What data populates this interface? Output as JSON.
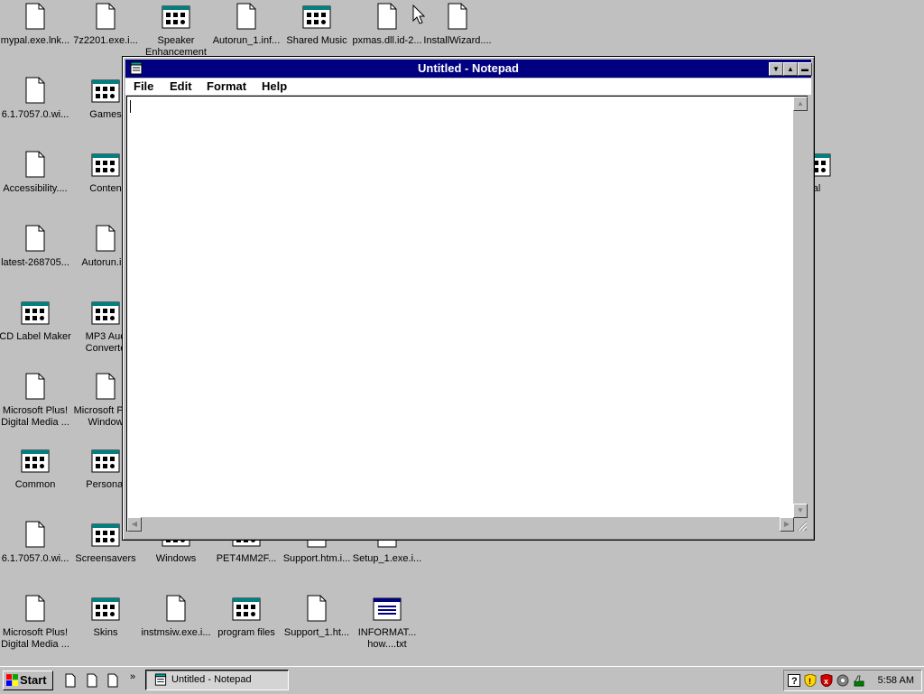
{
  "desktop": {
    "icons": [
      {
        "label": "mypal.exe.lnk...",
        "type": "doc"
      },
      {
        "label": "7z2201.exe.i...",
        "type": "doc"
      },
      {
        "label": "Speaker Enhancement",
        "type": "group"
      },
      {
        "label": "Autorun_1.inf...",
        "type": "doc"
      },
      {
        "label": "Shared Music",
        "type": "group"
      },
      {
        "label": "pxmas.dll.id-2...",
        "type": "doc"
      },
      {
        "label": "InstallWizard....",
        "type": "doc"
      },
      {
        "label": "6.1.7057.0.wi...",
        "type": "doc"
      },
      {
        "label": "Games",
        "type": "group"
      },
      {
        "label": "Accessibility....",
        "type": "doc"
      },
      {
        "label": "Conten",
        "type": "group"
      },
      {
        "label": "al",
        "type": "group"
      },
      {
        "label": "latest-268705...",
        "type": "doc"
      },
      {
        "label": "Autorun.inf",
        "type": "doc"
      },
      {
        "label": "CD Label Maker",
        "type": "group"
      },
      {
        "label": "MP3 Aud Converte",
        "type": "group"
      },
      {
        "label": "Microsoft Plus! Digital Media ...",
        "type": "doc"
      },
      {
        "label": "Microsoft P for Window",
        "type": "doc"
      },
      {
        "label": "Common",
        "type": "group"
      },
      {
        "label": "Personal",
        "type": "group"
      },
      {
        "label": "6.1.7057.0.wi...",
        "type": "doc"
      },
      {
        "label": "Screensavers",
        "type": "group"
      },
      {
        "label": "Windows",
        "type": "group"
      },
      {
        "label": "PET4MM2F...",
        "type": "group"
      },
      {
        "label": "Support.htm.i...",
        "type": "doc"
      },
      {
        "label": "Setup_1.exe.i...",
        "type": "doc"
      },
      {
        "label": "Microsoft Plus! Digital Media ...",
        "type": "doc"
      },
      {
        "label": "Skins",
        "type": "group"
      },
      {
        "label": "instmsiw.exe.i...",
        "type": "doc"
      },
      {
        "label": "program files",
        "type": "group"
      },
      {
        "label": "Support_1.ht...",
        "type": "doc"
      },
      {
        "label": "INFORMAT... how....txt",
        "type": "txt"
      }
    ]
  },
  "notepad": {
    "title": "Untitled - Notepad",
    "menu": [
      "File",
      "Edit",
      "Format",
      "Help"
    ],
    "content": ""
  },
  "taskbar": {
    "start_label": "Start",
    "task_label": "Untitled - Notepad",
    "clock": "5:58 AM"
  },
  "colors": {
    "desktop": "#c0c0c0",
    "titlebar": "#000080"
  }
}
